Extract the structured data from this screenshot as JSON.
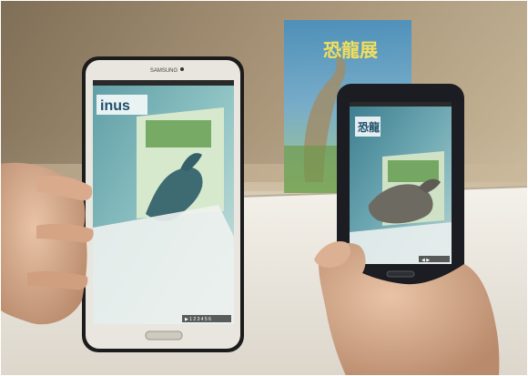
{
  "photo": {
    "left_phone": {
      "brand": "SAMSUNG",
      "screen_heading": "inus",
      "footer_text": "▶ 1 2 3 4 5 6"
    },
    "right_phone": {
      "screen_heading": "恐龍",
      "footer_text": "◀ ▶"
    },
    "poster": {
      "title": "恐龍展"
    }
  }
}
